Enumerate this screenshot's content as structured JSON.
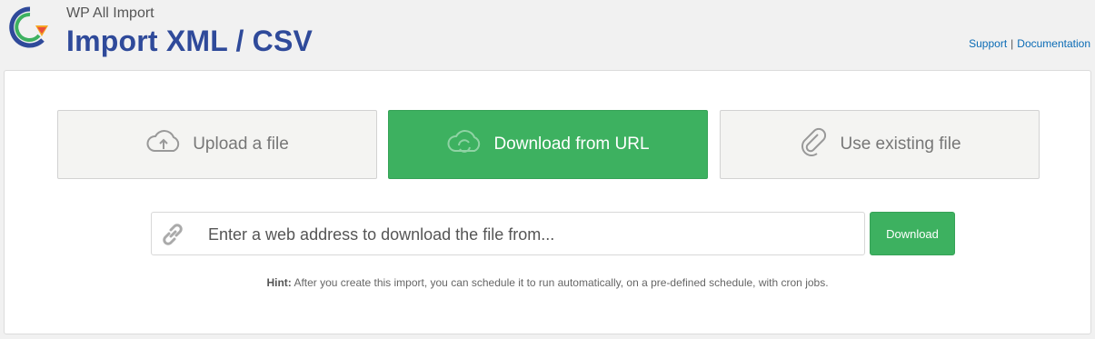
{
  "header": {
    "plugin_name": "WP All Import",
    "title": "Import XML / CSV",
    "links": {
      "support": "Support",
      "separator": "|",
      "documentation": "Documentation"
    }
  },
  "options": [
    {
      "label": "Upload a file",
      "icon": "cloud-upload-icon",
      "active": false
    },
    {
      "label": "Download from URL",
      "icon": "cloud-sync-icon",
      "active": true
    },
    {
      "label": "Use existing file",
      "icon": "paperclip-icon",
      "active": false
    }
  ],
  "url_input": {
    "placeholder": "Enter a web address to download the file from...",
    "value": "",
    "icon": "link-icon"
  },
  "download_button": "Download",
  "hint": {
    "label": "Hint:",
    "text": " After you create this import, you can schedule it to run automatically, on a pre-defined schedule, with cron jobs."
  },
  "colors": {
    "accent_green": "#3db160",
    "title_blue": "#2f4a9a",
    "link_blue": "#0a6bb5"
  }
}
